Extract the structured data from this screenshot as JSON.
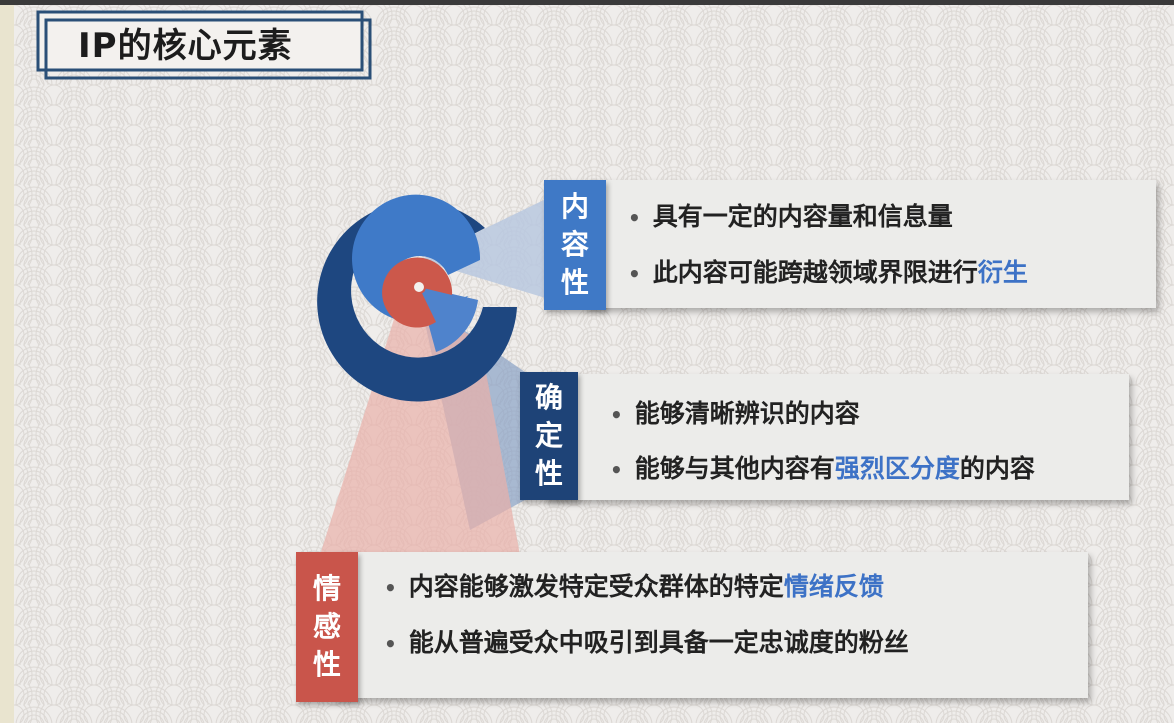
{
  "title": "IP的核心元素",
  "colors": {
    "dark_navy": "#1e4780",
    "mid_blue": "#3f7ac8",
    "red": "#c9544a",
    "highlight": "#3d72c6",
    "card_bg": "#ececea"
  },
  "elements": [
    {
      "tag_chars": [
        "内",
        "容",
        "性"
      ],
      "tag_color": "#3f79c6",
      "bullets": [
        {
          "parts": [
            "具有一定的内容量和信息量"
          ]
        },
        {
          "parts": [
            "此内容可能跨越领域界限进行"
          ],
          "highlight": "衍生",
          "after": ""
        }
      ]
    },
    {
      "tag_chars": [
        "确",
        "定",
        "性"
      ],
      "tag_color": "#1e4377",
      "bullets": [
        {
          "parts": [
            "能够清晰辨识的内容"
          ]
        },
        {
          "parts": [
            "能够与其他内容有"
          ],
          "highlight": "强烈区分度",
          "after": "的内容"
        }
      ]
    },
    {
      "tag_chars": [
        "情",
        "感",
        "性"
      ],
      "tag_color": "#c9554b",
      "bullets": [
        {
          "parts": [
            "内容能够激发特定受众群体的特定"
          ],
          "highlight": "情绪反馈",
          "after": ""
        },
        {
          "parts": [
            "能从普遍受众中吸引到具备一定忠诚度的粉丝"
          ]
        }
      ]
    }
  ],
  "bullet_symbol": "•"
}
